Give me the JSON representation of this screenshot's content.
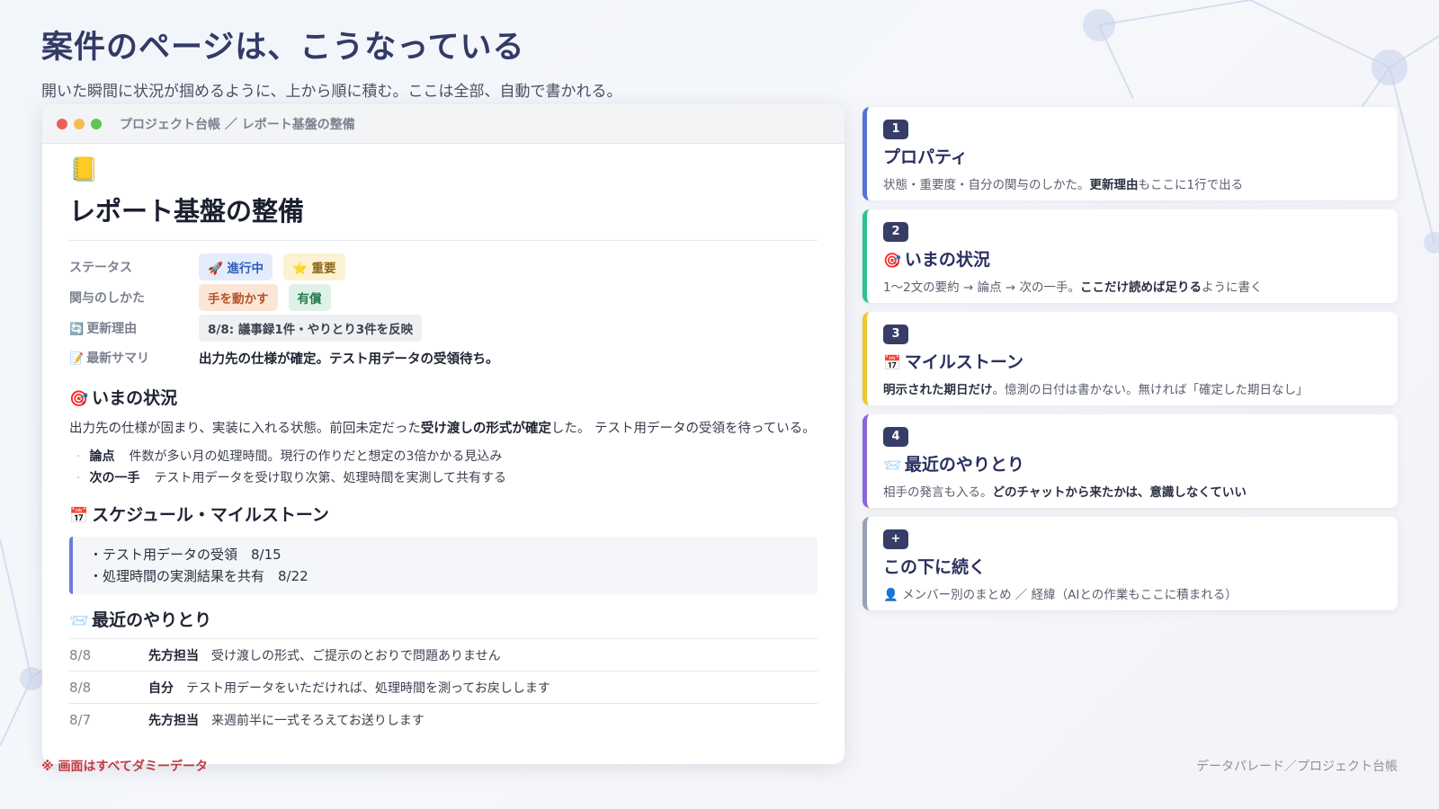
{
  "header": {
    "title": "案件のページは、こうなっている",
    "subtitle": "開いた瞬間に状況が掴めるように、上から順に積む。ここは全部、自動で書かれる。"
  },
  "window": {
    "breadcrumb": "プロジェクト台帳 ／ レポート基盤の整備",
    "doc_icon": "📒",
    "doc_title": "レポート基盤の整備",
    "properties": {
      "status": {
        "label": "ステータス",
        "tags": [
          "🚀 進行中",
          "⭐ 重要"
        ]
      },
      "involvement": {
        "label": "関与のしかた",
        "tags": [
          "手を動かす",
          "有償"
        ]
      },
      "update_reason": {
        "icon": "🔄",
        "label": "更新理由",
        "value": "8/8: 議事録1件・やりとり3件を反映"
      },
      "latest_summary": {
        "icon": "📝",
        "label": "最新サマリ",
        "value": "出力先の仕様が確定。テスト用データの受領待ち。"
      }
    },
    "status_section": {
      "icon": "🎯",
      "title": "いまの状況",
      "text_before": "出力先の仕様が固まり、実装に入れる状態。前回未定だった",
      "text_bold": "受け渡しの形式が確定",
      "text_after": "した。 テスト用データの受領を待っている。",
      "bullets": [
        {
          "key": "論点",
          "text": "件数が多い月の処理時間。現行の作りだと想定の3倍かかる見込み"
        },
        {
          "key": "次の一手",
          "text": "テスト用データを受け取り次第、処理時間を実測して共有する"
        }
      ]
    },
    "schedule_section": {
      "icon": "📅",
      "title": "スケジュール・マイルストーン",
      "items": [
        "・テスト用データの受領　8/15",
        "・処理時間の実測結果を共有　8/22"
      ]
    },
    "chat_section": {
      "icon": "📨",
      "title": "最近のやりとり",
      "rows": [
        {
          "date": "8/8",
          "who": "先方担当",
          "msg": "受け渡しの形式、ご提示のとおりで問題ありません"
        },
        {
          "date": "8/8",
          "who": "自分",
          "msg": "テスト用データをいただければ、処理時間を測ってお戻しします"
        },
        {
          "date": "8/7",
          "who": "先方担当",
          "msg": "来週前半に一式そろえてお送りします"
        }
      ]
    }
  },
  "cards": [
    {
      "badge": "1",
      "icon": "",
      "title": "プロパティ",
      "desc_before": "状態・重要度・自分の関与のしかた。",
      "desc_bold": "更新理由",
      "desc_after": "もここに1行で出る",
      "color": "#5572d2"
    },
    {
      "badge": "2",
      "icon": "🎯",
      "title": "いまの状況",
      "desc_before": "1〜2文の要約 → 論点 → 次の一手。",
      "desc_bold": "ここだけ読めば足りる",
      "desc_after": "ように書く",
      "color": "#2fbf94"
    },
    {
      "badge": "3",
      "icon": "📅",
      "title": "マイルストーン",
      "desc_before": "",
      "desc_bold": "明示された期日だけ",
      "desc_after": "。憶測の日付は書かない。無ければ「確定した期日なし」",
      "color": "#ecc72f"
    },
    {
      "badge": "4",
      "icon": "📨",
      "title": "最近のやりとり",
      "desc_before": "相手の発言も入る。",
      "desc_bold": "どのチャットから来たかは、意識しなくていい",
      "desc_after": "",
      "color": "#8a66d6"
    },
    {
      "badge": "+",
      "icon": "",
      "title": "この下に続く",
      "desc_before": "👤 メンバー別のまとめ ／ 経緯（AIとの作業もここに積まれる）",
      "desc_bold": "",
      "desc_after": "",
      "color": "#9aa0b4"
    }
  ],
  "footer": {
    "note": "※ 画面はすべてダミーデータ",
    "credit": "データパレード／プロジェクト台帳"
  }
}
